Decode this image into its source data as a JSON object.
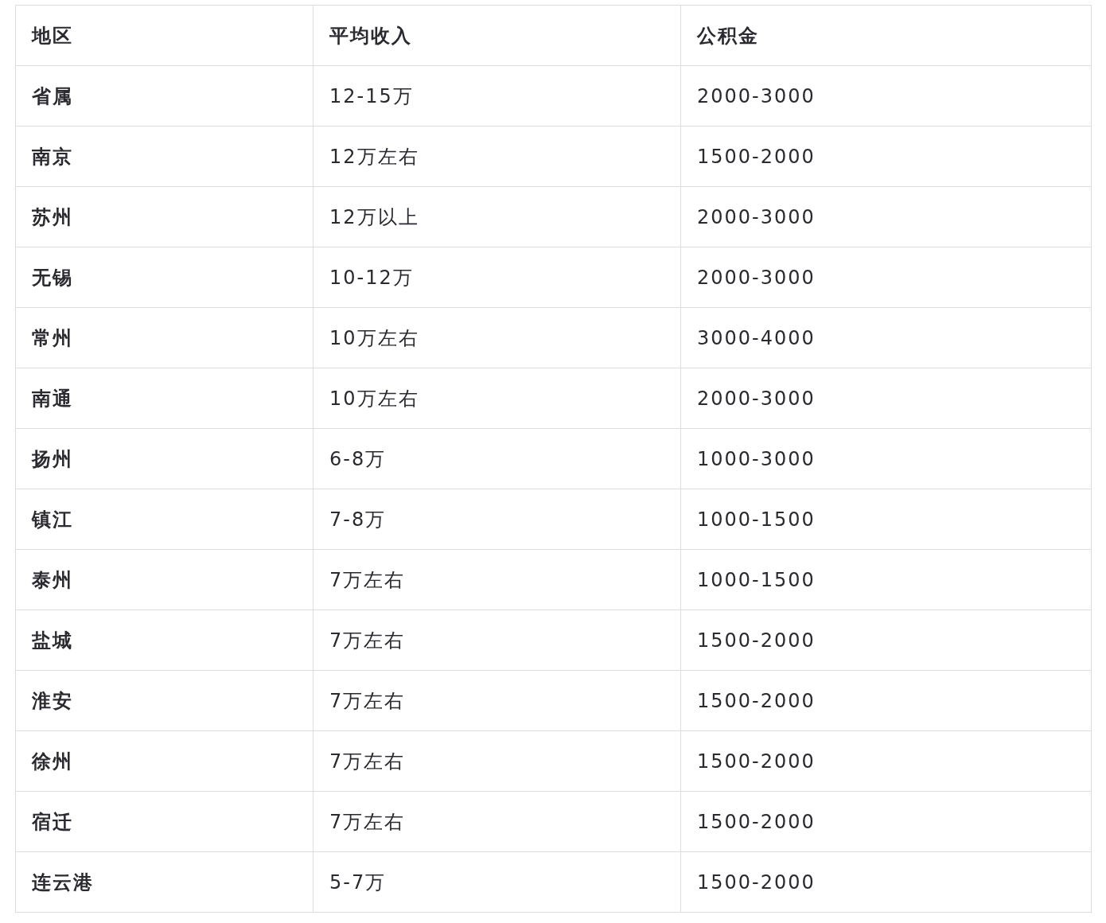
{
  "table": {
    "columns": [
      "地区",
      "平均收入",
      "公积金"
    ],
    "rows": [
      [
        "省属",
        "12-15万",
        "2000-3000"
      ],
      [
        "南京",
        "12万左右",
        "1500-2000"
      ],
      [
        "苏州",
        "12万以上",
        "2000-3000"
      ],
      [
        "无锡",
        "10-12万",
        "2000-3000"
      ],
      [
        "常州",
        "10万左右",
        "3000-4000"
      ],
      [
        "南通",
        "10万左右",
        "2000-3000"
      ],
      [
        "扬州",
        "6-8万",
        "1000-3000"
      ],
      [
        "镇江",
        "7-8万",
        "1000-1500"
      ],
      [
        "泰州",
        "7万左右",
        "1000-1500"
      ],
      [
        "盐城",
        "7万左右",
        "1500-2000"
      ],
      [
        "淮安",
        "7万左右",
        "1500-2000"
      ],
      [
        "徐州",
        "7万左右",
        "1500-2000"
      ],
      [
        "宿迁",
        "7万左右",
        "1500-2000"
      ],
      [
        "连云港",
        "5-7万",
        "1500-2000"
      ]
    ]
  }
}
